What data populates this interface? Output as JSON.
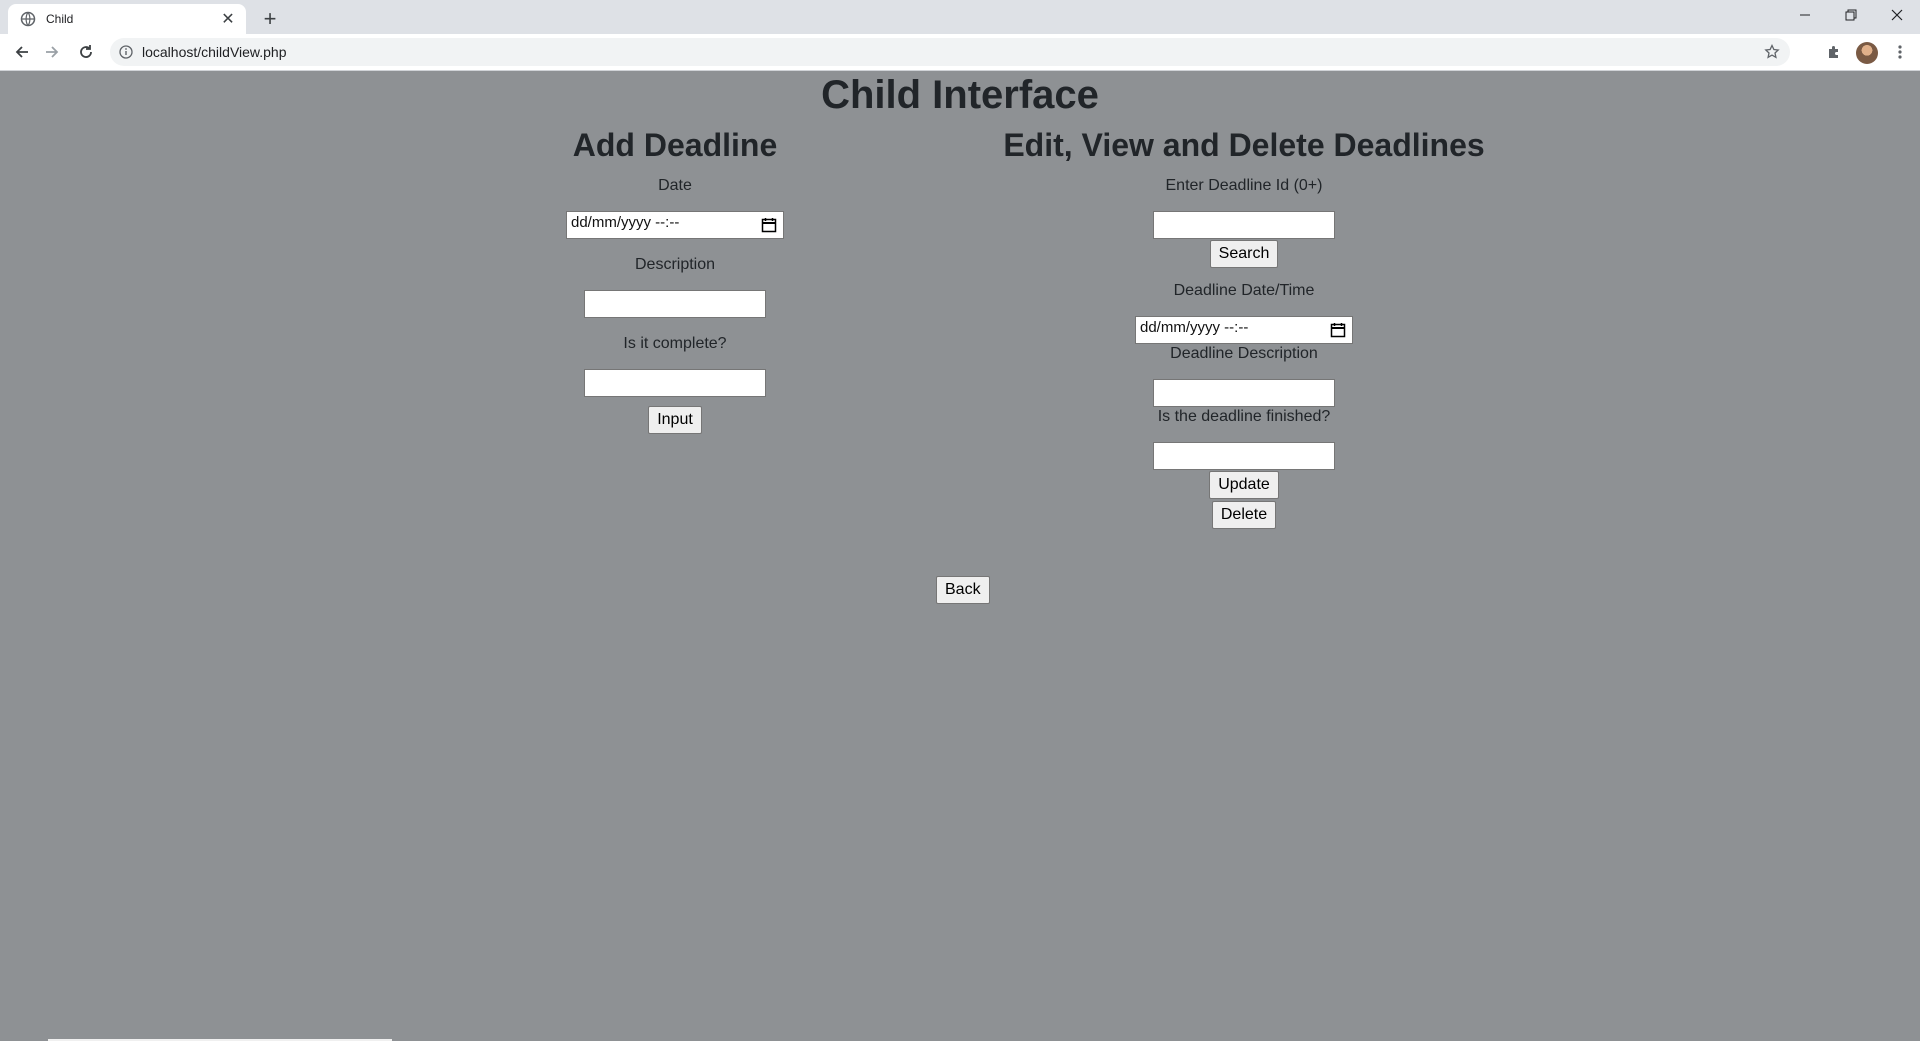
{
  "browser": {
    "tab_title": "Child",
    "url": "localhost/childView.php"
  },
  "page": {
    "title": "Child Interface",
    "add": {
      "heading": "Add Deadline",
      "date_label": "Date",
      "date_placeholder": "dd/mm/yyyy --:--",
      "description_label": "Description",
      "description_value": "",
      "complete_label": "Is it complete?",
      "complete_value": "",
      "input_button": "Input"
    },
    "edit": {
      "heading": "Edit, View and Delete Deadlines",
      "id_label": "Enter Deadline Id (0+)",
      "id_value": "",
      "search_button": "Search",
      "datetime_label": "Deadline Date/Time",
      "datetime_placeholder": "dd/mm/yyyy --:--",
      "description_label": "Deadline Description",
      "description_value": "",
      "finished_label": "Is the deadline finished?",
      "finished_value": "",
      "update_button": "Update",
      "delete_button": "Delete"
    },
    "back_button": "Back"
  },
  "colors": {
    "page_background": "#8e9194",
    "heading_text": "#212529"
  },
  "icons": [
    "globe-icon",
    "close-icon",
    "plus-icon",
    "minimize-icon",
    "restore-icon",
    "window-close-icon",
    "back-arrow-icon",
    "forward-arrow-icon",
    "reload-icon",
    "info-icon",
    "star-icon",
    "puzzle-icon",
    "kebab-menu-icon",
    "calendar-icon"
  ]
}
